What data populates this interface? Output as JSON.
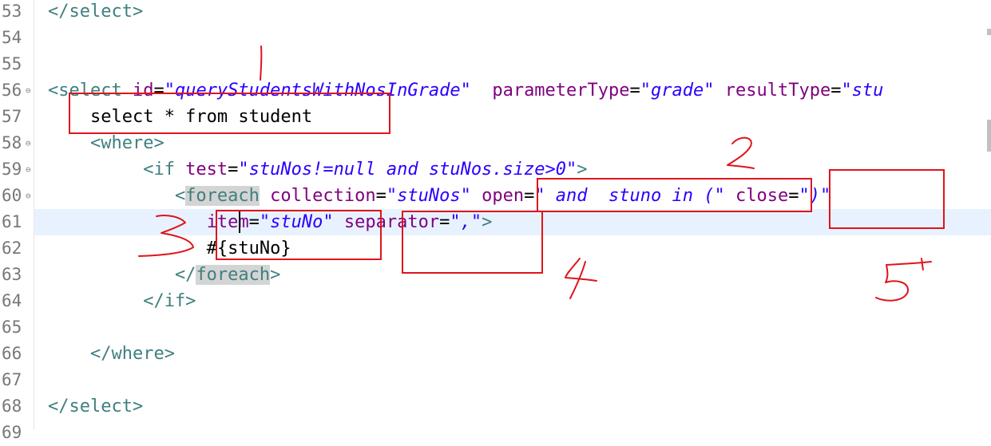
{
  "editor": {
    "lines": [
      {
        "num": "53",
        "fold": "",
        "tokens": [
          {
            "t": "</select>",
            "c": "tag"
          }
        ]
      },
      {
        "num": "54",
        "fold": "",
        "tokens": []
      },
      {
        "num": "55",
        "fold": "",
        "tokens": []
      },
      {
        "num": "56",
        "fold": "⊖",
        "tokens": [
          {
            "t": "<select ",
            "c": "tag"
          },
          {
            "t": "id",
            "c": "attr"
          },
          {
            "t": "=",
            "c": "txt"
          },
          {
            "t": "\"queryStudentsWithNosInGrade\"",
            "c": "str"
          },
          {
            "t": "  ",
            "c": "txt"
          },
          {
            "t": "parameterType",
            "c": "attr"
          },
          {
            "t": "=",
            "c": "txt"
          },
          {
            "t": "\"grade\"",
            "c": "str"
          },
          {
            "t": " ",
            "c": "txt"
          },
          {
            "t": "resultType",
            "c": "attr"
          },
          {
            "t": "=",
            "c": "txt"
          },
          {
            "t": "\"stu",
            "c": "str"
          }
        ]
      },
      {
        "num": "57",
        "fold": "",
        "tokens": [
          {
            "t": "    select * from student",
            "c": "txt"
          }
        ]
      },
      {
        "num": "58",
        "fold": "⊖",
        "tokens": [
          {
            "t": "    <where>",
            "c": "tag"
          }
        ]
      },
      {
        "num": "59",
        "fold": "⊖",
        "tokens": [
          {
            "t": "         <if ",
            "c": "tag"
          },
          {
            "t": "test",
            "c": "attr"
          },
          {
            "t": "=",
            "c": "txt"
          },
          {
            "t": "\"stuNos!=null and stuNos.size>0\"",
            "c": "str"
          },
          {
            "t": ">",
            "c": "tag"
          }
        ]
      },
      {
        "num": "60",
        "fold": "⊖",
        "tokens": [
          {
            "t": "            <",
            "c": "tag"
          },
          {
            "t": "foreach",
            "c": "tag hl"
          },
          {
            "t": " ",
            "c": "tag"
          },
          {
            "t": "collection",
            "c": "attr"
          },
          {
            "t": "=",
            "c": "txt"
          },
          {
            "t": "\"stuNos\"",
            "c": "str"
          },
          {
            "t": " ",
            "c": "txt"
          },
          {
            "t": "open",
            "c": "attr"
          },
          {
            "t": "=",
            "c": "txt"
          },
          {
            "t": "\" and  stuno in (\"",
            "c": "str"
          },
          {
            "t": " ",
            "c": "txt"
          },
          {
            "t": "close",
            "c": "attr"
          },
          {
            "t": "=",
            "c": "txt"
          },
          {
            "t": "\")\"",
            "c": "str"
          }
        ]
      },
      {
        "num": "61",
        "fold": "",
        "current": true,
        "tokens": [
          {
            "t": "               ",
            "c": "txt"
          },
          {
            "t": "item",
            "c": "attr"
          },
          {
            "t": "=",
            "c": "txt"
          },
          {
            "t": "\"stuNo\"",
            "c": "str"
          },
          {
            "t": " ",
            "c": "txt"
          },
          {
            "t": "separator",
            "c": "attr"
          },
          {
            "t": "=",
            "c": "txt"
          },
          {
            "t": "\",\"",
            "c": "str"
          },
          {
            "t": ">",
            "c": "tag"
          }
        ]
      },
      {
        "num": "62",
        "fold": "",
        "tokens": [
          {
            "t": "               #{stuNo}",
            "c": "txt"
          }
        ]
      },
      {
        "num": "63",
        "fold": "",
        "tokens": [
          {
            "t": "            </",
            "c": "tag"
          },
          {
            "t": "foreach",
            "c": "tag hl"
          },
          {
            "t": ">",
            "c": "tag"
          }
        ]
      },
      {
        "num": "64",
        "fold": "",
        "tokens": [
          {
            "t": "         </if>",
            "c": "tag"
          }
        ]
      },
      {
        "num": "65",
        "fold": "",
        "tokens": []
      },
      {
        "num": "66",
        "fold": "",
        "tokens": [
          {
            "t": "    </where>",
            "c": "tag"
          }
        ]
      },
      {
        "num": "67",
        "fold": "",
        "tokens": []
      },
      {
        "num": "68",
        "fold": "",
        "tokens": [
          {
            "t": "</select>",
            "c": "tag"
          }
        ]
      },
      {
        "num": "69",
        "fold": "",
        "tokens": []
      }
    ]
  },
  "annotations": {
    "numbers": [
      "1",
      "2",
      "3",
      "4",
      "5"
    ],
    "color": "#e0141c"
  },
  "colors": {
    "tag": "#3f7f7f",
    "attribute": "#7f007f",
    "string": "#2a00ff",
    "current_line": "#e8f2fe"
  }
}
